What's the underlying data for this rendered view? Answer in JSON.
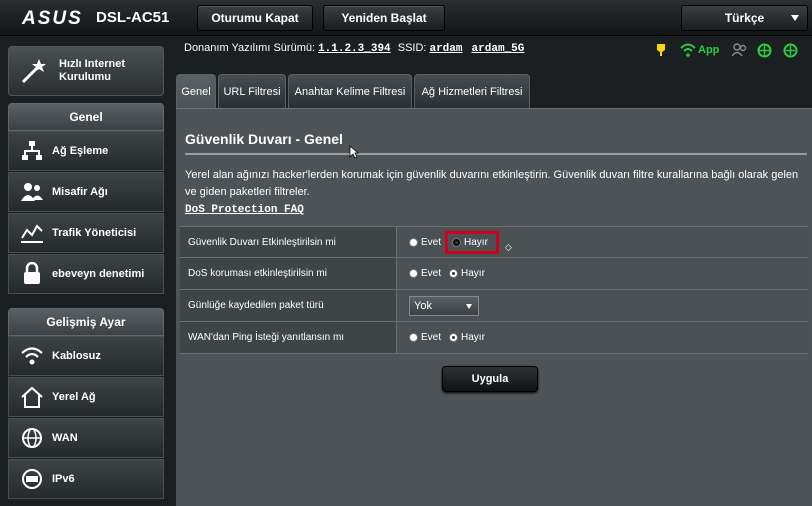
{
  "header": {
    "brand": "ASUS",
    "model": "DSL-AC51",
    "logout_label": "Oturumu Kapat",
    "reboot_label": "Yeniden Başlat",
    "language": "Türkçe"
  },
  "sidebar": {
    "qis_label_line1": "Hızlı Internet",
    "qis_label_line2": "Kurulumu",
    "general_header": "Genel",
    "general_items": [
      {
        "label": "Ağ Eşleme",
        "icon": "network-map-icon"
      },
      {
        "label": "Misafir Ağı",
        "icon": "guest-network-icon"
      },
      {
        "label": "Trafik Yöneticisi",
        "icon": "traffic-manager-icon"
      },
      {
        "label": "ebeveyn denetimi",
        "icon": "lock-icon"
      }
    ],
    "advanced_header": "Gelişmiş Ayar",
    "advanced_items": [
      {
        "label": "Kablosuz",
        "icon": "wifi-icon"
      },
      {
        "label": "Yerel Ağ",
        "icon": "home-icon"
      },
      {
        "label": "WAN",
        "icon": "globe-icon"
      },
      {
        "label": "IPv6",
        "icon": "ipv6-icon"
      }
    ]
  },
  "info": {
    "firmware_label": "Donanım Yazılımı Sürümü:",
    "firmware_value": "1.1.2.3_394",
    "ssid_label": "SSID:",
    "ssid_1": "ardam",
    "ssid_2": "ardam_5G",
    "app_label": "App"
  },
  "tabs": [
    {
      "label": "Genel",
      "active": true
    },
    {
      "label": "URL Filtresi",
      "active": false
    },
    {
      "label": "Anahtar Kelime Filtresi",
      "active": false
    },
    {
      "label": "Ağ Hizmetleri Filtresi",
      "active": false
    }
  ],
  "main": {
    "title": "Güvenlik Duvarı - Genel",
    "description": "Yerel alan ağınızı hacker'lerden korumak için güvenlik duvarını etkinleştirin. Güvenlik duvarı filtre kurallarına bağlı olarak gelen ve giden paketleri filtreler.",
    "faq_link": "DoS Protection FAQ",
    "rows": [
      {
        "label": "Güvenlik Duvarı Etkinleştirilsin mi",
        "yes": "Evet",
        "no": "Hayır",
        "selected": "no"
      },
      {
        "label": "DoS koruması etkinleştirilsin mi",
        "yes": "Evet",
        "no": "Hayır",
        "selected": "no"
      },
      {
        "label": "Günlüğe kaydedilen paket türü",
        "select_value": "Yok"
      },
      {
        "label": "WAN'dan Ping İsteği yanıtlansın mı",
        "yes": "Evet",
        "no": "Hayır",
        "selected": "no"
      }
    ],
    "apply_label": "Uygula"
  },
  "colors": {
    "highlight": "#d0021b",
    "wifi_green": "#2ecc40",
    "led_yellow": "#f5d90a"
  }
}
